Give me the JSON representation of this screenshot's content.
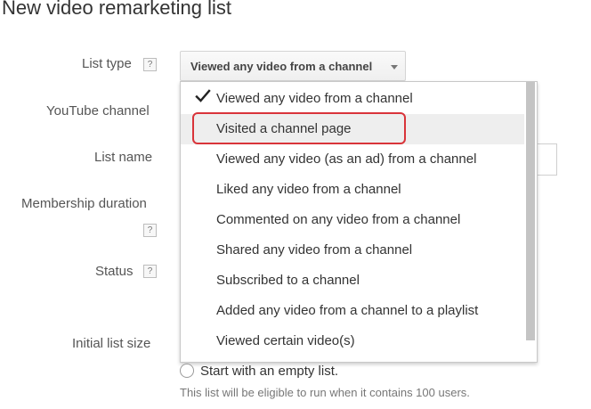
{
  "page": {
    "title": "New video remarketing list"
  },
  "form": {
    "list_type_label": "List type",
    "youtube_channel_label": "YouTube channel",
    "list_name_label": "List name",
    "membership_duration_label": "Membership duration",
    "status_label": "Status",
    "initial_list_size_label": "Initial list size",
    "help_glyph": "?"
  },
  "list_type_select": {
    "selected": "Viewed any video from a channel",
    "icon": "chevron-down-icon"
  },
  "dropdown": {
    "items": [
      {
        "label": "Viewed any video from a channel",
        "checked": true
      },
      {
        "label": "Visited a channel page",
        "highlighted": true
      },
      {
        "label": "Viewed any video (as an ad) from a channel"
      },
      {
        "label": "Liked any video from a channel"
      },
      {
        "label": "Commented on any video from a channel"
      },
      {
        "label": "Shared any video from a channel"
      },
      {
        "label": "Subscribed to a channel"
      },
      {
        "label": "Added any video from a channel to a playlist"
      },
      {
        "label": "Viewed certain video(s)"
      }
    ]
  },
  "initial_list_size": {
    "option_label": "Start with an empty list.",
    "note": "This list will be eligible to run when it contains 100 users."
  },
  "colors": {
    "annotation": "#d9343a",
    "hover_row": "#eeeeee",
    "scrollbar": "#c4c4c4"
  }
}
